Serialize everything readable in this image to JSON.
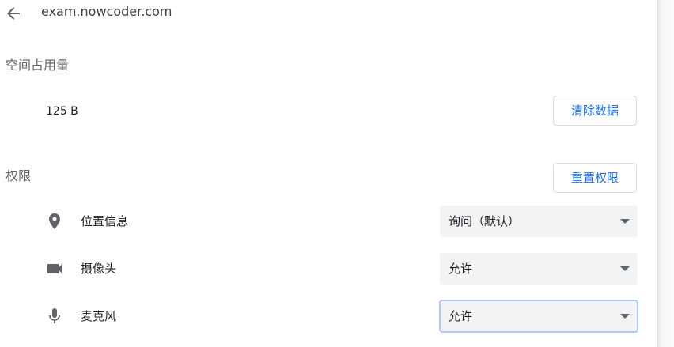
{
  "header": {
    "title": "exam.nowcoder.com",
    "back_icon": "arrow-back-icon"
  },
  "storage": {
    "section_title": "空间占用量",
    "value": "125 B",
    "clear_button": "清除数据"
  },
  "permissions": {
    "section_title": "权限",
    "reset_button": "重置权限",
    "items": [
      {
        "label": "位置信息",
        "icon": "location-pin-icon",
        "value": "询问（默认）"
      },
      {
        "label": "摄像头",
        "icon": "videocam-icon",
        "value": "允许"
      },
      {
        "label": "麦克风",
        "icon": "microphone-icon",
        "value": "允许"
      }
    ]
  },
  "colors": {
    "accent": "#1a73e8",
    "select_bg": "#f1f3f4",
    "focus_ring": "#aecbfa",
    "icon": "#5f6368"
  }
}
